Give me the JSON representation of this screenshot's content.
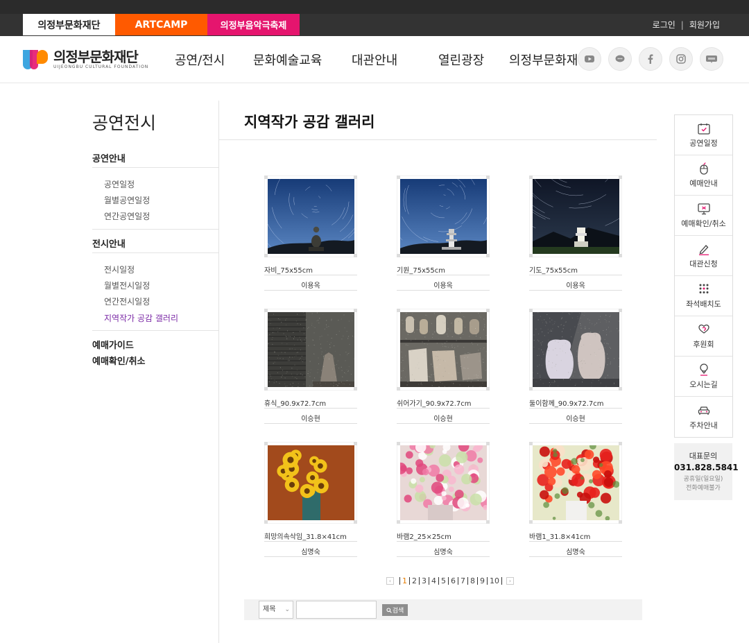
{
  "topbar": {
    "tabs": [
      "의정부문화재단",
      "ARTCAMP",
      "의정부음악극축제"
    ],
    "links": [
      "로그인",
      "회원가입"
    ]
  },
  "header": {
    "logo_ko": "의정부문화재단",
    "logo_en": "UIJEONGBU CULTURAL FOUNDATION",
    "nav": [
      "공연/전시",
      "문화예술교육",
      "대관안내",
      "열린광장",
      "의정부문화재"
    ],
    "sns": [
      "youtube-icon",
      "talk-icon",
      "facebook-icon",
      "instagram-icon",
      "blog-icon"
    ]
  },
  "sidebar": {
    "title": "공연전시",
    "groups": [
      {
        "label": "공연안내",
        "items": [
          "공연일정",
          "월별공연일정",
          "연간공연일정"
        ]
      },
      {
        "label": "전시안내",
        "items": [
          "전시일정",
          "월별전시일정",
          "연간전시일정",
          "지역작가 공감 갤러리"
        ]
      },
      {
        "label": "예매가이드",
        "items": []
      },
      {
        "label": "예매확인/취소",
        "items": []
      }
    ],
    "active": "지역작가 공감 갤러리"
  },
  "main": {
    "title": "지역작가 공감 갤러리",
    "gallery": [
      {
        "caption": "자비_75x55cm",
        "artist": "이용옥",
        "art": "night1"
      },
      {
        "caption": "기원_75x55cm",
        "artist": "이용옥",
        "art": "night2"
      },
      {
        "caption": "기도_75x55cm",
        "artist": "이용옥",
        "art": "night3"
      },
      {
        "caption": "휴식_90.9x72.7cm",
        "artist": "이승현",
        "art": "still1"
      },
      {
        "caption": "쉬어가기_90.9x72.7cm",
        "artist": "이승현",
        "art": "still2"
      },
      {
        "caption": "둘이함께_90.9x72.7cm",
        "artist": "이승현",
        "art": "still3"
      },
      {
        "caption": "희망의속삭임_31.8×41cm",
        "artist": "심명숙",
        "art": "flower1"
      },
      {
        "caption": "바램2_25×25cm",
        "artist": "심명숙",
        "art": "flower2"
      },
      {
        "caption": "바램1_31.8×41cm",
        "artist": "심명숙",
        "art": "flower3"
      }
    ],
    "pagination": {
      "pages": [
        "1",
        "2",
        "3",
        "4",
        "5",
        "6",
        "7",
        "8",
        "9",
        "10"
      ],
      "current": "1"
    },
    "search": {
      "field": "제목",
      "value": "",
      "button": "검색"
    }
  },
  "quick_menu": [
    {
      "label": "공연일정",
      "icon": "calendar-check-icon"
    },
    {
      "label": "예매안내",
      "icon": "mouse-icon"
    },
    {
      "label": "예매확인/취소",
      "icon": "monitor-icon"
    },
    {
      "label": "대관신청",
      "icon": "pencil-icon"
    },
    {
      "label": "좌석배치도",
      "icon": "seat-grid-icon"
    },
    {
      "label": "후원회",
      "icon": "heart-hand-icon"
    },
    {
      "label": "오시는길",
      "icon": "location-icon"
    },
    {
      "label": "주차안내",
      "icon": "car-icon"
    }
  ],
  "contact": {
    "title": "대표문의",
    "phone": "031.828.5841",
    "note1": "공휴일(일요일)",
    "note2": "전화예매불가"
  },
  "colors": {
    "artcamp": "#ff5a00",
    "festival": "#e5156e",
    "active_menu": "#7b2aa6",
    "current_page": "#e57b00"
  }
}
